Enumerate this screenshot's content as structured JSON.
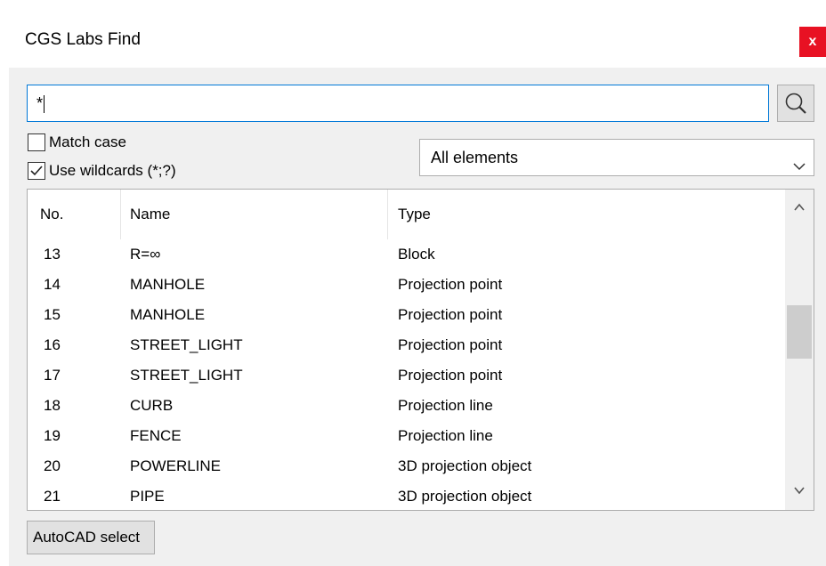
{
  "window": {
    "title": "CGS Labs Find",
    "close_label": "x"
  },
  "search": {
    "value": "*",
    "button_icon": "magnifier-icon"
  },
  "options": {
    "match_case_label": "Match case",
    "match_case_checked": false,
    "use_wildcards_label": "Use wildcards (*;?)",
    "use_wildcards_checked": true
  },
  "filter": {
    "selected": "All elements"
  },
  "table": {
    "columns": [
      "No.",
      "Name",
      "Type"
    ],
    "rows": [
      {
        "no": "13",
        "name": "R=∞",
        "type": "Block"
      },
      {
        "no": "14",
        "name": "MANHOLE",
        "type": "Projection point"
      },
      {
        "no": "15",
        "name": "MANHOLE",
        "type": "Projection point"
      },
      {
        "no": "16",
        "name": "STREET_LIGHT",
        "type": "Projection point"
      },
      {
        "no": "17",
        "name": "STREET_LIGHT",
        "type": "Projection point"
      },
      {
        "no": "18",
        "name": "CURB",
        "type": "Projection line"
      },
      {
        "no": "19",
        "name": "FENCE",
        "type": "Projection line"
      },
      {
        "no": "20",
        "name": "POWERLINE",
        "type": "3D projection object"
      },
      {
        "no": "21",
        "name": "PIPE",
        "type": "3D projection object"
      }
    ]
  },
  "footer": {
    "autocad_button_label": "AutoCAD select"
  }
}
